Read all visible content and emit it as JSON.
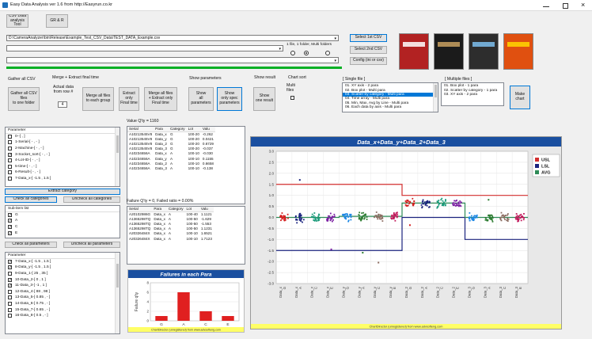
{
  "window": {
    "title": "Easy Data Analysis ver 1.6 from http://Easyrun.co.kr",
    "app_icon": "chart-icon"
  },
  "toolbar": {
    "csv_tool": "CSV Data\nanalysis Tool",
    "gr_rr": "GR & R"
  },
  "paths": {
    "csv_path": "D:\\CameraAnalyzer\\bin\\Release\\Example_Test_CSV_Data\\TEST_DATA_Example.csv",
    "path2": "",
    "path3": ""
  },
  "buttons": {
    "select_1st": "Select 1st CSV",
    "select_2nd": "Select 2nd CSV",
    "config": "Config (ini or csv)",
    "gather_csv": "Gather all CSV\nfiles\nto one folder",
    "merge_group": "Merge all files\nto each group",
    "extract_final": "Extract\nonly\nFinal time",
    "merge_extract": "Merge all files\n+ Extract only\nFinal time",
    "show_all": "Show\nall\nparameters",
    "show_spec": "Show\nonly spec\nparameters",
    "show_one": "Show\none result",
    "make_chart": "Make\nchart",
    "extract_category": "Extract category",
    "check_all_cat": "Check all categories",
    "uncheck_all_cat": "Uncheck all categories",
    "check_all_params": "Check all parameters",
    "uncheck_all_params": "Uncheck all parameters"
  },
  "folder_option": {
    "label": "1 file, 1 folder, Multi folders",
    "selected_index": 1
  },
  "sections": {
    "gather": "Gather all CSV",
    "merge": "Merge + Extract final time",
    "actual_data": "Actual data\nfrom row #",
    "row_value": "4",
    "show_params": "Show parameters",
    "show_result": "Show result",
    "chart_sort": "Chart sort",
    "multi_files": "Multi\nfiles",
    "single_file": "[ Single file ]",
    "multiple_files": "[ Multiple files ]"
  },
  "single_file_list": [
    "01. XY axis - 2 para",
    "02. Box plot - Multi para",
    "03. Scatter by category - Multi para",
    "04. Time array - Multi para",
    "05. Min, Max, Avg by Line - Multi para",
    "06. Each data by axis - Multi para"
  ],
  "single_file_selected": 2,
  "multiple_files_list": [
    "01. Box plot - 1 para",
    "02. Scatter by category - 1 para",
    "03. XY axis - 2 para"
  ],
  "param_list_top": {
    "header": "Parameter",
    "items": [
      {
        "label": "0--[ , ]",
        "checked": false
      },
      {
        "label": "1-Serial-[ - , - ]",
        "checked": false
      },
      {
        "label": "2-Machine-[ - , - ]",
        "checked": false
      },
      {
        "label": "3-Socket_sort-[ - , - ]",
        "checked": true
      },
      {
        "label": "4-Lot-ID-[ - , - ]",
        "checked": false
      },
      {
        "label": "5-time-[ - , - ]",
        "checked": false
      },
      {
        "label": "6-Result-[ - , - ]",
        "checked": false
      },
      {
        "label": "7-Data_x-[ -1.5 , 1.5 ]",
        "checked": false
      }
    ]
  },
  "sub_item": {
    "header": "Sub-item list",
    "items": [
      {
        "label": "G",
        "checked": true
      },
      {
        "label": "A",
        "checked": true
      },
      {
        "label": "C",
        "checked": true
      },
      {
        "label": "E",
        "checked": true
      }
    ]
  },
  "param_list_bottom": {
    "header": "Parameter",
    "items": [
      {
        "label": "7-Data_x-[ -1.5 , 1.5 ]",
        "checked": true
      },
      {
        "label": "8-Data_y-[ -1.5 , 1.5 ]",
        "checked": true
      },
      {
        "label": "9-Data_1-[ 25 , 35 ]",
        "checked": false
      },
      {
        "label": "10-Data_2-[ 0 , 1 ]",
        "checked": true
      },
      {
        "label": "11-Data_3-[ -1 , 1 ]",
        "checked": true
      },
      {
        "label": "12-Data_4-[ 88 , 98 ]",
        "checked": false
      },
      {
        "label": "13-Data_5-[ 0.85 , - ]",
        "checked": false
      },
      {
        "label": "14-Data_6-[ 0.75 , - ]",
        "checked": false
      },
      {
        "label": "15-Data_7-[ 0.65 , - ]",
        "checked": false
      },
      {
        "label": "16-Data_8-[ 0.5 , - ]",
        "checked": false
      }
    ]
  },
  "value_table": {
    "title": "Value Q'ty = 1160",
    "columns": [
      "Serial",
      "Para",
      "Category",
      "Lot",
      "Valu"
    ],
    "rows": [
      [
        "A10213545V8",
        "Data_x",
        "G",
        "100-20",
        "-0.262"
      ],
      [
        "A10213545V8",
        "Data_y",
        "G",
        "100-20",
        "0.0421"
      ],
      [
        "A10213545V8",
        "Data_2",
        "G",
        "100-20",
        "0.6729"
      ],
      [
        "A10213545V8",
        "Data_3",
        "G",
        "100-20",
        "-0.037"
      ],
      [
        "A10234656A",
        "Data_x",
        "A",
        "100-10",
        "-0.030"
      ],
      [
        "A10234656A",
        "Data_y",
        "A",
        "100-10",
        "0.1155"
      ],
      [
        "A10234656A",
        "Data_2",
        "A",
        "100-10",
        "0.6658"
      ],
      [
        "A10234656A",
        "Data_3",
        "A",
        "100-10",
        "-0.138"
      ]
    ]
  },
  "failure_table": {
    "title": "Failure Q'ty = 0, Failed ratio = 0.00%",
    "columns": [
      "Serial",
      "Para",
      "Category",
      "Lot",
      "Valu"
    ],
    "rows": [
      [
        "A20102986G",
        "Data_x",
        "A",
        "100-40",
        "1.1121"
      ],
      [
        "A1365298TQ",
        "Data_x",
        "A",
        "100-50",
        "-1.629"
      ],
      [
        "A1365298TQ",
        "Data_x",
        "A",
        "100-50",
        "-1.553"
      ],
      [
        "A1365298TQ",
        "Data_x",
        "A",
        "100-50",
        "1.1231"
      ],
      [
        "A20326484X",
        "Data_x",
        "A",
        "100-10",
        "1.6521"
      ],
      [
        "A20326484X",
        "Data_x",
        "A",
        "100-10",
        "1.7123"
      ]
    ]
  },
  "footer": "ChartDirector (unregistered) from www.advsofteng.com",
  "chart_data": [
    {
      "type": "bar",
      "title": "Failures in each Para",
      "ylabel": "Failure q'ty",
      "categories": [
        "G",
        "A",
        "C",
        "E"
      ],
      "values": [
        1,
        6,
        2,
        1
      ],
      "ylim": [
        0,
        8
      ],
      "yticks": [
        0,
        2,
        4,
        6,
        8
      ],
      "grid": true,
      "color": "#e02020"
    },
    {
      "type": "scatter",
      "title": "Data_x+Data_y+Data_2+Data_3",
      "categories": [
        "Data_x G",
        "Data_x A",
        "Data_x C",
        "Data_x E",
        "Data_y G",
        "Data_y A",
        "Data_y C",
        "Data_y E",
        "Data_2 G",
        "Data_2 A",
        "Data_2 C",
        "Data_2 E",
        "Data_3 G",
        "Data_3 A",
        "Data_3 C",
        "Data_3 E"
      ],
      "tick_labels": [
        [
          "Data_x",
          "G"
        ],
        [
          "Data_x",
          "A"
        ],
        [
          "Data_x",
          "C"
        ],
        [
          "Data_x",
          "E"
        ],
        [
          "Data_y",
          "G"
        ],
        [
          "Data_y",
          "A"
        ],
        [
          "Data_y",
          "C"
        ],
        [
          "Data_y",
          "E"
        ],
        [
          "Data_2",
          "G"
        ],
        [
          "Data_2",
          "A"
        ],
        [
          "Data_2",
          "C"
        ],
        [
          "Data_2",
          "E"
        ],
        [
          "Data_3",
          "G"
        ],
        [
          "Data_3",
          "A"
        ],
        [
          "Data_3",
          "C"
        ],
        [
          "Data_3",
          "E"
        ]
      ],
      "ylim": [
        -3.0,
        3.0
      ],
      "yticks": [
        3.0,
        2.5,
        2.0,
        1.5,
        1.0,
        0.5,
        0.0,
        -0.5,
        -1.0,
        -1.5,
        -2.0,
        -2.5,
        -3.0
      ],
      "usl": [
        1.5,
        1.5,
        1.5,
        1.5,
        1.5,
        1.5,
        1.5,
        1.5,
        1.0,
        1.0,
        1.0,
        1.0,
        1.0,
        1.0,
        1.0,
        1.0
      ],
      "lsl": [
        -1.5,
        -1.5,
        -1.5,
        -1.5,
        -1.5,
        -1.5,
        -1.5,
        -1.5,
        0.0,
        0.0,
        0.0,
        0.0,
        -1.0,
        -1.0,
        -1.0,
        -1.0
      ],
      "avg": [
        0.0,
        0.0,
        0.0,
        0.0,
        0.05,
        0.05,
        0.05,
        0.05,
        0.65,
        0.65,
        0.65,
        0.65,
        0.0,
        0.0,
        0.0,
        0.0
      ],
      "series_colors": [
        "#d42020",
        "#1a237e",
        "#1a9a7a",
        "#7b1fa2",
        "#1e88e5",
        "#2e7d32",
        "#8d6e63",
        "#c2185b"
      ],
      "legend": [
        "USL",
        "LSL",
        "AVG"
      ],
      "legend_colors": [
        "#d32f2f",
        "#1a237e",
        "#2e8b57"
      ],
      "grid": true,
      "background": "#ffffff"
    }
  ],
  "book_covers": [
    {
      "color": "#b22222",
      "accent": "#ffffff"
    },
    {
      "color": "#1b1b1b",
      "accent": "#c8a060"
    },
    {
      "color": "#2d2d2d",
      "accent": "#7ec0ee"
    },
    {
      "color": "#e05010",
      "accent": "#ffd700"
    }
  ]
}
